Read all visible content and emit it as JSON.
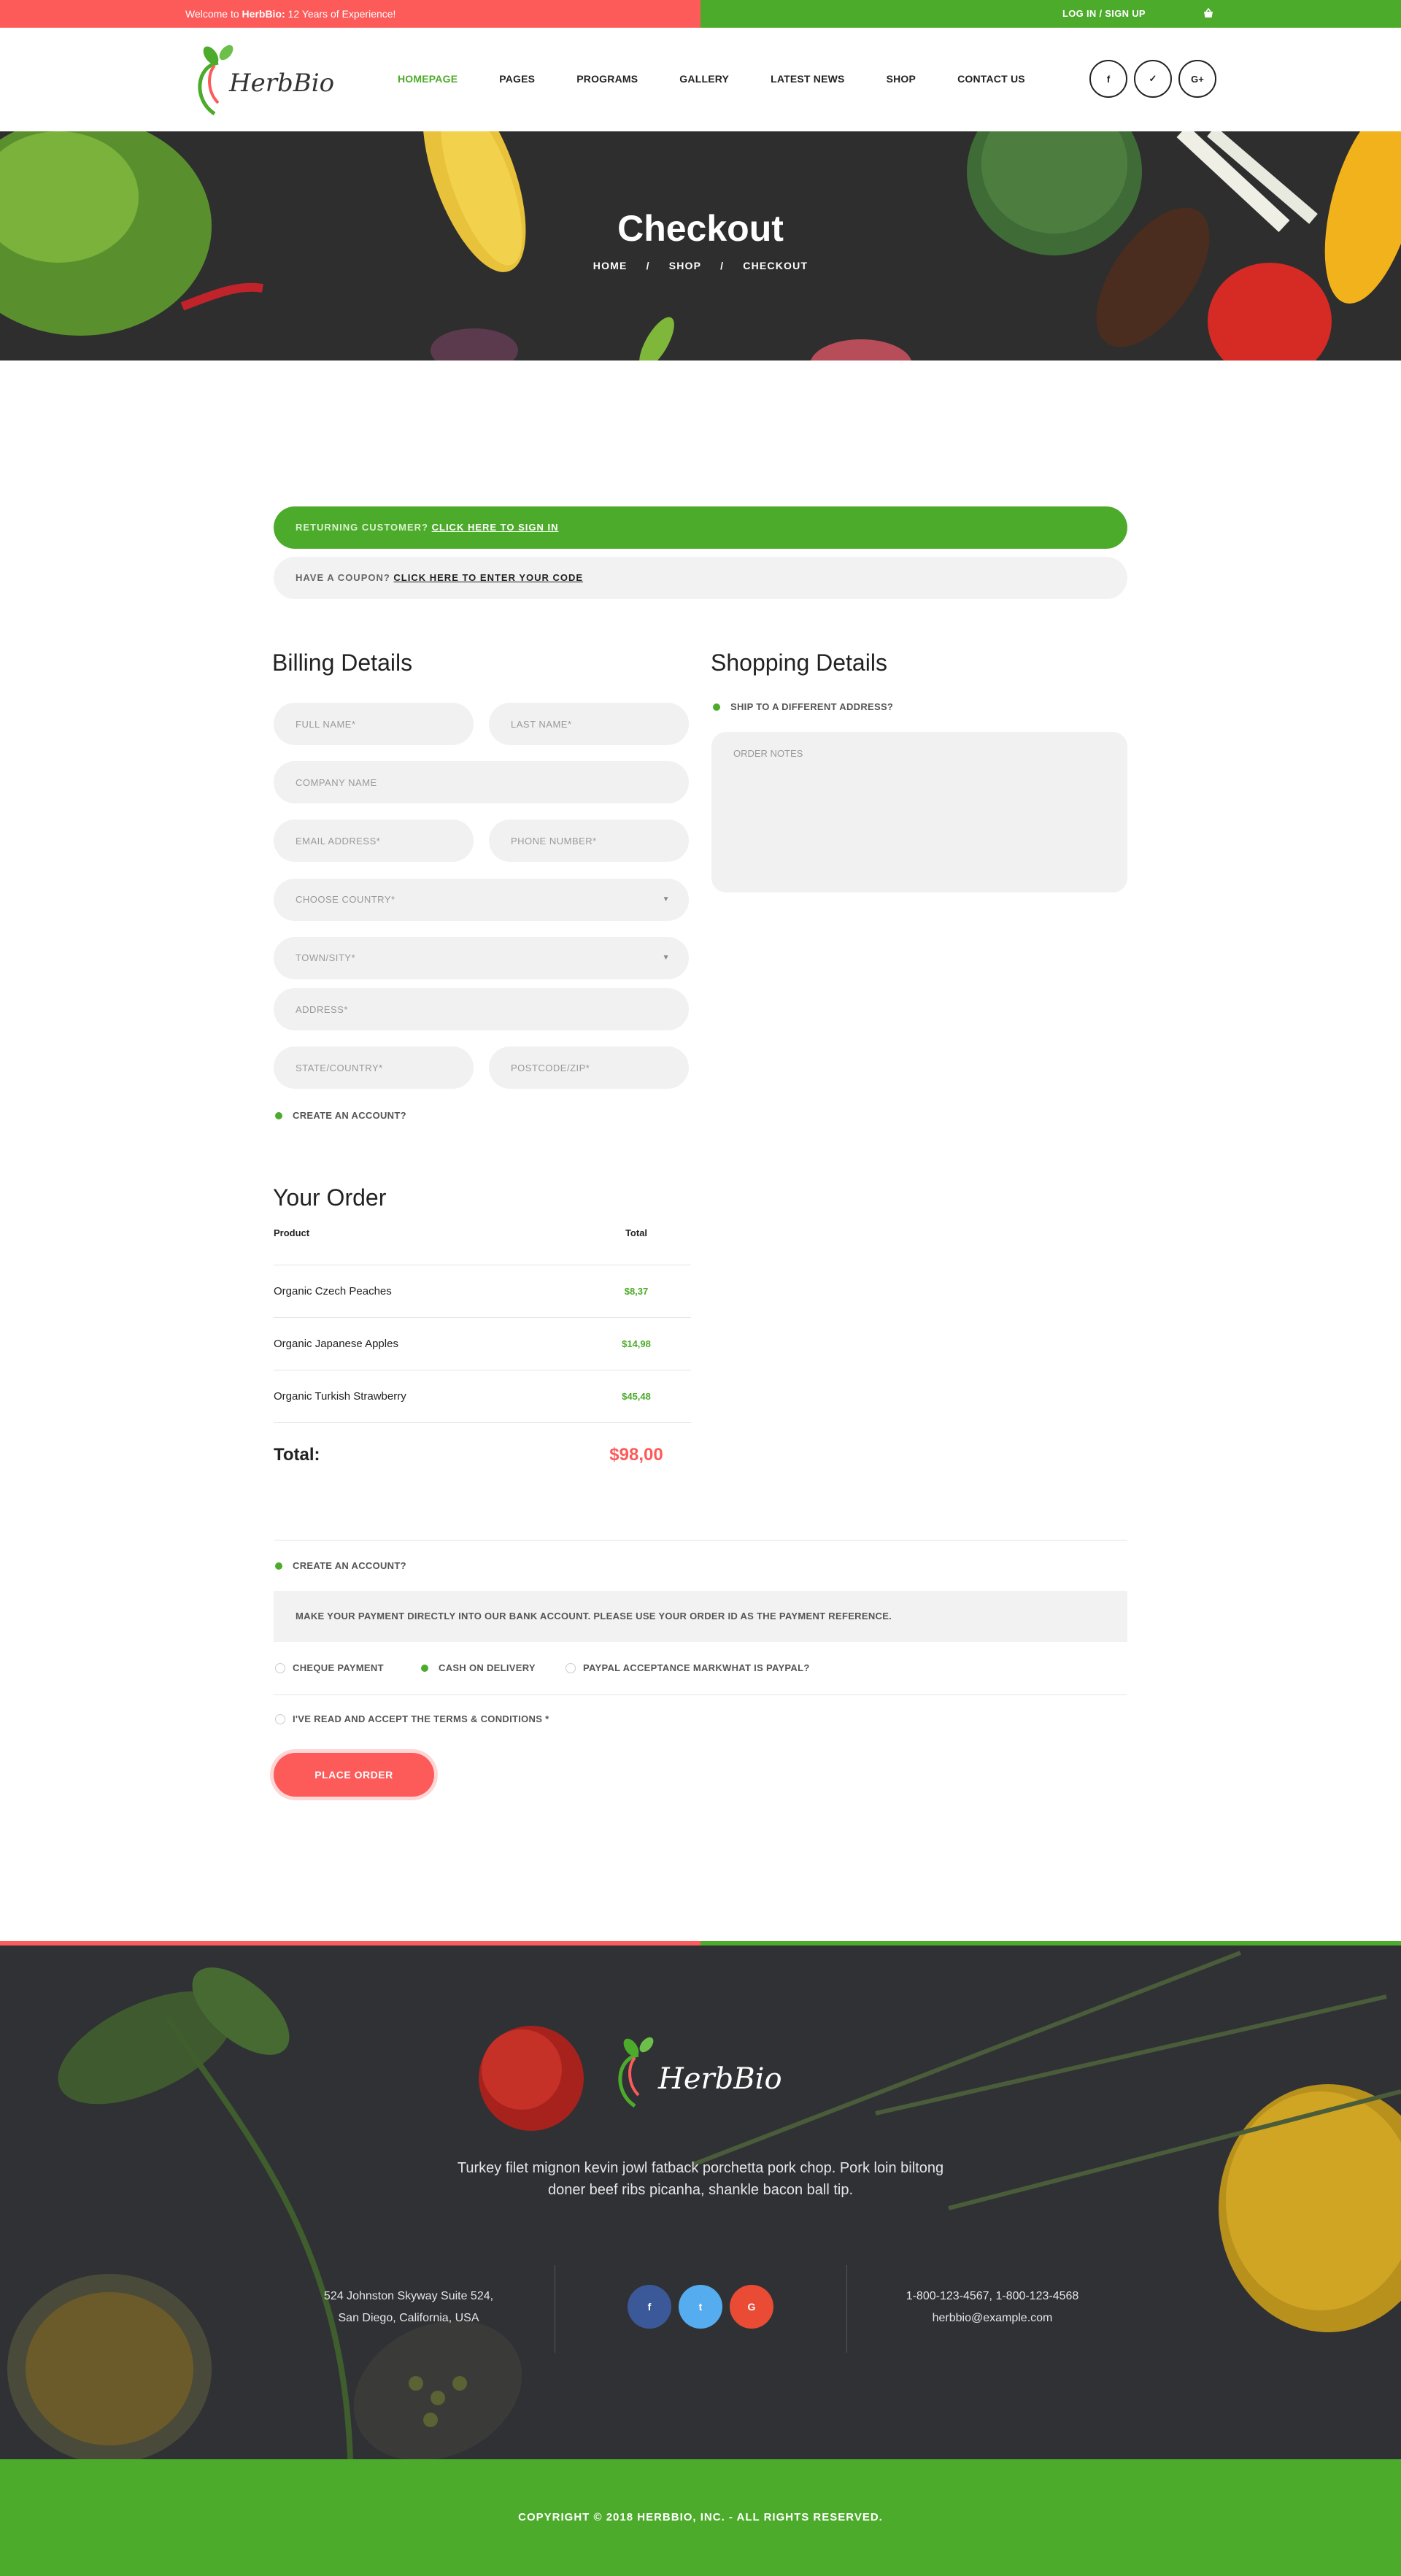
{
  "topbar": {
    "welcome_prefix": "Welcome to ",
    "welcome_brand": "HerbBio:",
    "welcome_suffix": " 12 Years of Experience!",
    "login": "LOG IN / SIGN UP",
    "cart_icon": "basket-icon"
  },
  "header": {
    "brand": "HerbBio",
    "nav": [
      "HOMEPAGE",
      "PAGES",
      "PROGRAMS",
      "GALLERY",
      "LATEST NEWS",
      "SHOP",
      "CONTACT US"
    ],
    "social": [
      "f",
      "✓",
      "G+"
    ]
  },
  "hero": {
    "title": "Checkout",
    "crumbs": [
      "HOME",
      "SHOP",
      "CHECKOUT"
    ],
    "sep": "/"
  },
  "banners": {
    "returning_prefix": "RETURNING CUSTOMER? ",
    "returning_link": "CLICK HERE TO SIGN IN",
    "coupon_prefix": "HAVE A COUPON? ",
    "coupon_link": "CLICK HERE TO ENTER YOUR CODE"
  },
  "billing": {
    "title": "Billing Details",
    "full_name": "FULL NAME*",
    "last_name": "LAST NAME*",
    "company": "COMPANY NAME",
    "email": "EMAIL ADDRESS*",
    "phone": "PHONE NUMBER*",
    "country": "CHOOSE COUNTRY*",
    "town": "TOWN/SITY*",
    "address": "ADDRESS*",
    "state": "STATE/COUNTRY*",
    "postcode": "POSTCODE/ZIP*",
    "create_account": "CREATE AN ACCOUNT?"
  },
  "shopping": {
    "title": "Shopping Details",
    "ship_different": "SHIP TO A DIFFERENT ADDRESS?",
    "order_notes": "ORDER NOTES"
  },
  "order": {
    "title": "Your Order",
    "col_product": "Product",
    "col_total": "Total",
    "rows": [
      {
        "product": "Organic Czech Peaches",
        "price": "$8,37"
      },
      {
        "product": "Organic Japanese Apples",
        "price": "$14,98"
      },
      {
        "product": "Organic Turkish Strawberry",
        "price": "$45,48"
      }
    ],
    "total_label": "Total:",
    "total_value": "$98,00"
  },
  "payment": {
    "create_account": "CREATE AN ACCOUNT?",
    "note": "MAKE YOUR PAYMENT DIRECTLY INTO OUR BANK ACCOUNT. PLEASE USE YOUR ORDER ID AS THE PAYMENT REFERENCE.",
    "options": [
      "CHEQUE PAYMENT",
      "CASH ON DELIVERY",
      "PAYPAL ACCEPTANCE MARKWHAT IS PAYPAL?"
    ],
    "selected": "CASH ON DELIVERY",
    "terms": "I'VE READ AND ACCEPT THE TERMS & CONDITIONS *",
    "place_order": "PLACE ORDER"
  },
  "footer": {
    "brand": "HerbBio",
    "text_line1": "Turkey filet mignon kevin jowl fatback porchetta pork chop. Pork loin biltong",
    "text_line2": "doner beef ribs picanha, shankle bacon ball tip.",
    "addr_line1": "524 Johnston Skyway Suite 524,",
    "addr_line2": "San Diego, California, USA",
    "phone": "1-800-123-4567, 1-800-123-4568",
    "email": "herbbio@example.com",
    "social": [
      "f",
      "t",
      "G"
    ],
    "social_colors": [
      "#3b5998",
      "#55acee",
      "#e94b35"
    ],
    "copyright": "COPYRIGHT © 2018 HERBBIO, INC. - ALL RIGHTS RESERVED."
  },
  "colors": {
    "accent_green": "#4cab2a",
    "accent_red": "#fd5a5a"
  }
}
